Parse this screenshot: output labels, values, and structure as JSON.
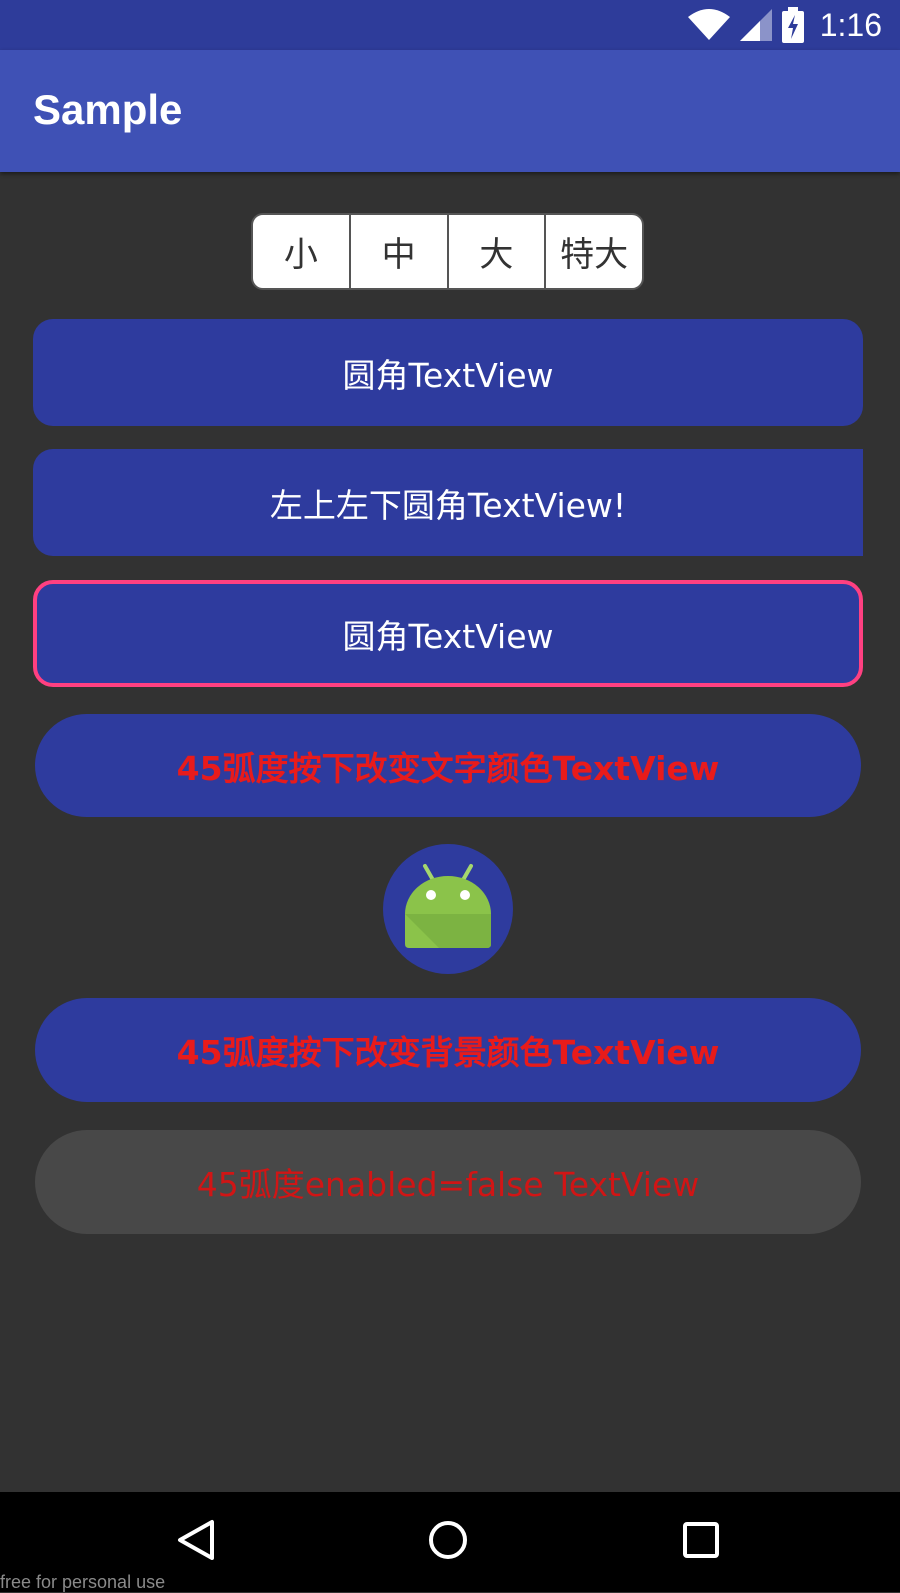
{
  "status_bar": {
    "time": "1:16",
    "icons": [
      "wifi-icon",
      "cell-signal-icon",
      "battery-charging-icon"
    ]
  },
  "app_bar": {
    "title": "Sample"
  },
  "size_selector": {
    "options": [
      "小",
      "中",
      "大",
      "特大"
    ]
  },
  "textviews": {
    "rounded": "圆角TextView",
    "left_rounded": "左上左下圆角TextView!",
    "rounded_border": "圆角TextView",
    "press_text_color": "45弧度按下改变文字颜色TextView",
    "press_background": "45弧度按下改变背景颜色TextView",
    "disabled": "45弧度enabled=false TextView"
  },
  "avatar": {
    "icon": "android-robot-icon"
  },
  "nav_bar": {
    "icons": [
      "back-icon",
      "home-icon",
      "recents-icon"
    ]
  },
  "watermark": "free for personal use",
  "colors": {
    "primary": "#3f51b5",
    "primary_dark": "#2e3c9a",
    "button_bg": "#2e3b9e",
    "accent": "#ff4081",
    "red_text": "#e81b1b",
    "disabled_bg": "#484848",
    "background": "#323232"
  }
}
